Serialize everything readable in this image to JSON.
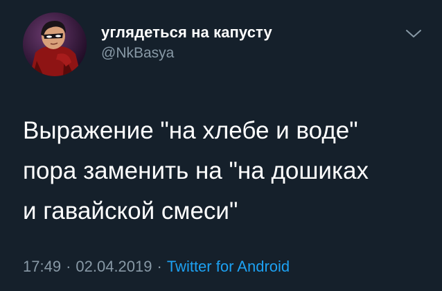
{
  "tweet": {
    "author": {
      "display_name": "углядеться на капусту",
      "handle": "@NkBasya",
      "avatar_icon": "avatar-image"
    },
    "menu_icon": "chevron-down-icon",
    "text_lines": [
      "Выражение \"на хлебе и воде\"",
      "пора заменить на \"на дошиках",
      "и гавайской смеси\""
    ],
    "meta": {
      "time": "17:49",
      "separator": "·",
      "date": "02.04.2019",
      "source": "Twitter for Android"
    }
  },
  "colors": {
    "background": "#15202b",
    "primary_text": "#ffffff",
    "secondary_text": "#8899a6",
    "link": "#1da1f2"
  }
}
